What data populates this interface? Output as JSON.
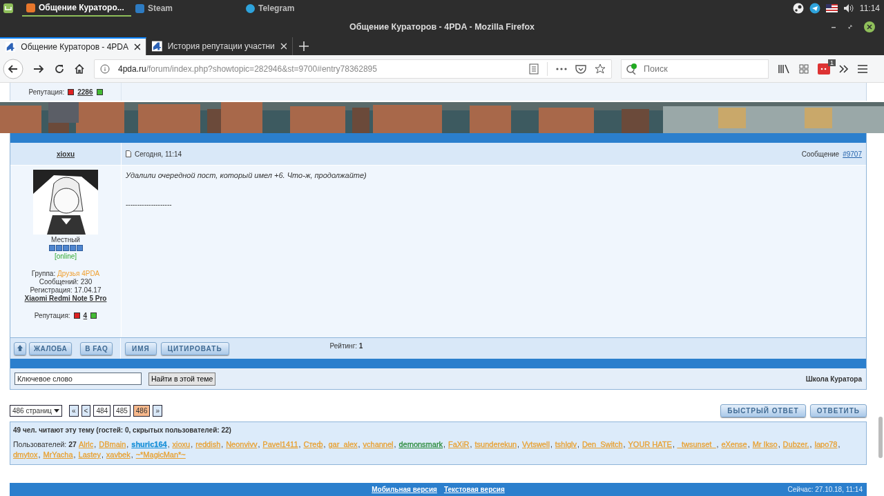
{
  "taskbar": {
    "items": [
      {
        "label": "Общение Кураторо...",
        "selected": true
      },
      {
        "label": "Steam",
        "selected": false
      },
      {
        "label": "Telegram",
        "selected": false
      }
    ],
    "clock": "11:14"
  },
  "window": {
    "title": "Общение Кураторов - 4PDA - Mozilla Firefox"
  },
  "browser_tabs": [
    {
      "label": "Общение Кураторов - 4PDA",
      "selected": true
    },
    {
      "label": "История репутации участни",
      "selected": false
    }
  ],
  "address_bar": {
    "host": "4pda.ru",
    "path": "/forum/index.php?showtopic=282946&st=9700#entry78362895"
  },
  "search": {
    "placeholder": "Поиск"
  },
  "extension_badge": "1",
  "previous_post": {
    "reputation_label": "Репутация:",
    "reputation": "2286"
  },
  "post": {
    "author": {
      "name": "xioxu",
      "rank": "Местный",
      "stars": 5,
      "status": "[online]",
      "group_label": "Группа:",
      "group": "Друзья 4PDA",
      "messages": "Сообщений: 230",
      "registered": "Регистрация: 17.04.17",
      "device": "Xiaomi Redmi Note 5 Pro",
      "reputation_label": "Репутация:",
      "reputation": "4"
    },
    "date": "Сегодня, 11:14",
    "message_label": "Сообщение",
    "message_link": "#9707",
    "text": "Удалили очередной пост, который имел +6. Что-ж, продолжайте)",
    "signature": "--------------------",
    "left_buttons": [
      "ЖАЛОБА",
      "В FAQ"
    ],
    "right_buttons": [
      "ИМЯ",
      "ЦИТИРОВАТЬ"
    ],
    "rating_label": "Рейтинг:",
    "rating": "1"
  },
  "topic_search": {
    "placeholder": "Ключевое слово",
    "button": "Найти в этой теме",
    "forum": "Школа Куратора"
  },
  "pagination": {
    "pages_select": "486 страниц",
    "first": "«",
    "prev": "<",
    "next": "»",
    "pages": [
      {
        "label": "484",
        "selected": false
      },
      {
        "label": "485",
        "selected": false
      },
      {
        "label": "486",
        "selected": true
      }
    ]
  },
  "reply_buttons": [
    "БЫСТРЫЙ ОТВЕТ",
    "ОТВЕТИТЬ"
  ],
  "readers": {
    "title": "49 чел. читают эту тему (гостей: 0, скрытых пользователей: 22)",
    "users_label": "Пользователей:",
    "users_count": "27",
    "separator": ",",
    "users": [
      {
        "name": "Alrlc",
        "color": "#e8a030",
        "bold": false
      },
      {
        "name": "DBmain",
        "color": "#e8a030",
        "bold": false
      },
      {
        "name": "shuric164",
        "color": "#1a90d8",
        "bold": true
      },
      {
        "name": "xioxu",
        "color": "#e8a030",
        "bold": false
      },
      {
        "name": "reddish",
        "color": "#e8a030",
        "bold": false
      },
      {
        "name": "Neonvivv",
        "color": "#e8a030",
        "bold": false
      },
      {
        "name": "Pavel1411",
        "color": "#e8a030",
        "bold": false
      },
      {
        "name": "Стеф",
        "color": "#e8a030",
        "bold": false
      },
      {
        "name": "gar_alex",
        "color": "#e8a030",
        "bold": false
      },
      {
        "name": "vchannel",
        "color": "#e8a030",
        "bold": false
      },
      {
        "name": "demonsmark",
        "color": "#2a8a3a",
        "bold": false
      },
      {
        "name": "FaXiR",
        "color": "#e8a030",
        "bold": false
      },
      {
        "name": "tsunderekun",
        "color": "#e8a030",
        "bold": false
      },
      {
        "name": "Vytswell",
        "color": "#e8a030",
        "bold": false
      },
      {
        "name": "tshlglv",
        "color": "#e8a030",
        "bold": false
      },
      {
        "name": "Den_Switch",
        "color": "#e8a030",
        "bold": false
      },
      {
        "name": "YOUR HATE",
        "color": "#e8a030",
        "bold": false
      },
      {
        "name": "_twsunset_",
        "color": "#e8a030",
        "bold": false
      },
      {
        "name": "eXense",
        "color": "#e8a030",
        "bold": false
      },
      {
        "name": "Mr Ikso",
        "color": "#e8a030",
        "bold": false
      },
      {
        "name": "Dubzer.",
        "color": "#e8a030",
        "bold": false
      },
      {
        "name": "lapo78",
        "color": "#e8a030",
        "bold": false
      },
      {
        "name": "dmytox",
        "color": "#e8a030",
        "bold": false
      },
      {
        "name": "MrYacha",
        "color": "#e8a030",
        "bold": false
      },
      {
        "name": "Lastey",
        "color": "#e8a030",
        "bold": false
      },
      {
        "name": "xavbek",
        "color": "#e8a030",
        "bold": false
      },
      {
        "name": "~*MagicMan*~",
        "color": "#e8a030",
        "bold": false
      }
    ]
  },
  "footer": {
    "links": [
      "Мобильная версия",
      "Текстовая версия"
    ],
    "now": "Сейчас: 27.10.18, 11:14"
  }
}
